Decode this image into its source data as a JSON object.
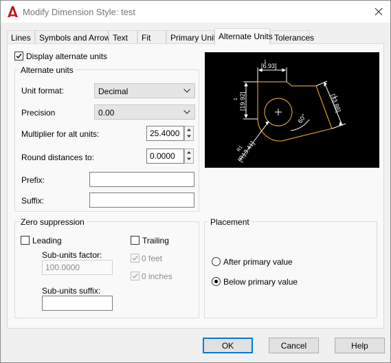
{
  "window": {
    "title": "Modify Dimension Style: test"
  },
  "tabs": [
    "Lines",
    "Symbols and Arrows",
    "Text",
    "Fit",
    "Primary Units",
    "Alternate Units",
    "Tolerances"
  ],
  "active_tab": "Alternate Units",
  "display_alt_units": {
    "label": "Display alternate units",
    "checked": true
  },
  "alt_units": {
    "title": "Alternate units",
    "unit_format_label": "Unit format:",
    "unit_format_value": "Decimal",
    "precision_label": "Precision",
    "precision_value": "0.00",
    "multiplier_label": "Multiplier for alt units:",
    "multiplier_value": "25.4000",
    "round_label": "Round distances  to:",
    "round_value": "0.0000",
    "prefix_label": "Prefix:",
    "prefix_value": "",
    "suffix_label": "Suffix:",
    "suffix_value": ""
  },
  "zero_suppression": {
    "title": "Zero suppression",
    "leading_label": "Leading",
    "leading_checked": false,
    "trailing_label": "Trailing",
    "trailing_checked": false,
    "subunits_factor_label": "Sub-units factor:",
    "subunits_factor_value": "100.0000",
    "subunits_suffix_label": "Sub-units suffix:",
    "subunits_suffix_value": "",
    "zero_feet_label": "0 feet",
    "zero_inches_label": "0 inches"
  },
  "placement": {
    "title": "Placement",
    "after_label": "After primary value",
    "below_label": "Below primary value",
    "selected": "below"
  },
  "preview": {
    "top_value": "1",
    "top_alt": "[6.93]",
    "left_value": "1",
    "left_alt": "[19.92]",
    "right_value": "1",
    "right_alt": "[33.88]",
    "angle": "60°",
    "radius_value": "R1",
    "radius_alt": "[R13.41]"
  },
  "buttons": {
    "ok": "OK",
    "cancel": "Cancel",
    "help": "Help"
  },
  "colors": {
    "accent": "#0078d7",
    "app_icon": "#c4161c",
    "preview_lines": "#ffffff",
    "preview_geometry": "#d89a2b"
  }
}
